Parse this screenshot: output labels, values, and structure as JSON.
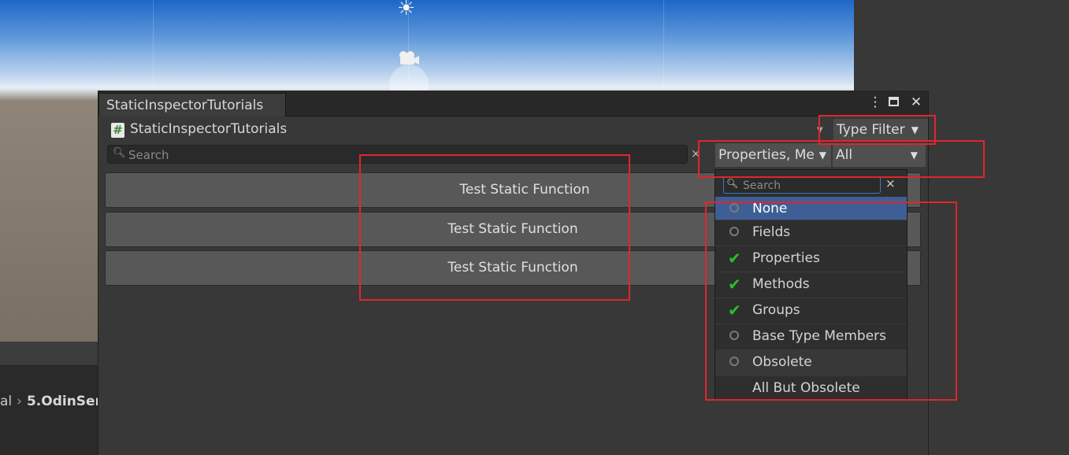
{
  "window": {
    "tab_title": "StaticInspectorTutorials",
    "header_title": "StaticInspectorTutorials",
    "type_filter_label": "Type Filter",
    "search_placeholder": "Search",
    "members_filter_value": "Properties, Me",
    "access_filter_value": "All"
  },
  "buttons": [
    {
      "label": "Test Static Function"
    },
    {
      "label": "Test Static Function"
    },
    {
      "label": "Test Static Function"
    }
  ],
  "dropdown": {
    "search_placeholder": "Search",
    "items": [
      {
        "label": "None",
        "state": "unchecked",
        "selected": true
      },
      {
        "label": "Fields",
        "state": "unchecked"
      },
      {
        "label": "Properties",
        "state": "checked"
      },
      {
        "label": "Methods",
        "state": "checked"
      },
      {
        "label": "Groups",
        "state": "checked"
      },
      {
        "label": "Base Type Members",
        "state": "unchecked"
      },
      {
        "label": "Obsolete",
        "state": "unchecked"
      },
      {
        "label": "All But Obsolete",
        "state": "none"
      }
    ]
  },
  "breadcrumb": {
    "prev": "al",
    "current": "5.OdinSer"
  },
  "colors": {
    "annotation_red": "#e0262c",
    "selected_blue": "#3e5f96",
    "check_green": "#27c22a"
  }
}
